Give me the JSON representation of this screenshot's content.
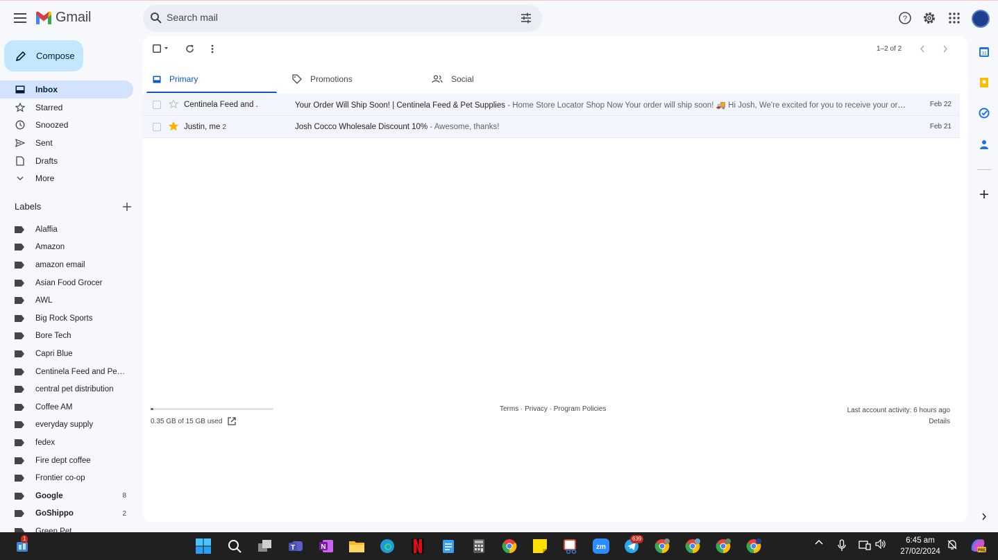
{
  "app": {
    "name": "Gmail"
  },
  "search": {
    "placeholder": "Search mail"
  },
  "compose": {
    "label": "Compose"
  },
  "nav": [
    {
      "label": "Inbox",
      "icon": "inbox-icon",
      "active": true
    },
    {
      "label": "Starred",
      "icon": "star-icon"
    },
    {
      "label": "Snoozed",
      "icon": "clock-icon"
    },
    {
      "label": "Sent",
      "icon": "send-icon"
    },
    {
      "label": "Drafts",
      "icon": "draft-icon"
    },
    {
      "label": "More",
      "icon": "chevron-down-icon"
    }
  ],
  "labels_header": "Labels",
  "labels": [
    {
      "name": "Alaffia",
      "count": ""
    },
    {
      "name": "Amazon",
      "count": ""
    },
    {
      "name": "amazon email",
      "count": ""
    },
    {
      "name": "Asian Food Grocer",
      "count": ""
    },
    {
      "name": "AWL",
      "count": ""
    },
    {
      "name": "Big Rock Sports",
      "count": ""
    },
    {
      "name": "Bore Tech",
      "count": ""
    },
    {
      "name": "Capri Blue",
      "count": ""
    },
    {
      "name": "Centinela Feed and Pet ...",
      "count": ""
    },
    {
      "name": "central pet distribution",
      "count": ""
    },
    {
      "name": "Coffee AM",
      "count": ""
    },
    {
      "name": "everyday supply",
      "count": ""
    },
    {
      "name": "fedex",
      "count": ""
    },
    {
      "name": "Fire dept coffee",
      "count": ""
    },
    {
      "name": "Frontier co-op",
      "count": ""
    },
    {
      "name": "Google",
      "count": "8",
      "bold": true
    },
    {
      "name": "GoShippo",
      "count": "2",
      "bold": true
    },
    {
      "name": "Green Pet",
      "count": ""
    }
  ],
  "toolbar": {
    "pager": "1–2 of 2"
  },
  "tabs": [
    {
      "label": "Primary",
      "icon": "inbox-icon"
    },
    {
      "label": "Promotions",
      "icon": "tag-icon"
    },
    {
      "label": "Social",
      "icon": "people-icon"
    }
  ],
  "emails": [
    {
      "sender": "Centinela Feed and .",
      "count": "",
      "starred": false,
      "subject": "Your Order Will Ship Soon! | Centinela Feed & Pet Supplies",
      "snippet": " - Home Store Locator Shop Now Your order will ship soon! 🚚 Hi Josh, We're excited for you to receive your order. Please see details below",
      "date": "Feb 22"
    },
    {
      "sender": "Justin, me",
      "count": "2",
      "starred": true,
      "subject": "Josh Cocco Wholesale Discount 10%",
      "snippet": " - Awesome, thanks!",
      "date": "Feb 21"
    }
  ],
  "storage": {
    "text": "0.35 GB of 15 GB used",
    "fraction": 0.023
  },
  "footer": {
    "links": "Terms · Privacy · Program Policies"
  },
  "activity": {
    "text": "Last account activity: 6 hours ago",
    "details": "Details"
  },
  "taskbar": {
    "start_badge": "1",
    "telegram_badge": "639",
    "time": "6:45 am",
    "date": "27/02/2024"
  },
  "colors": {
    "accent": "#0b57d0",
    "compose": "#c2e7ff",
    "active_nav": "#d3e3fd",
    "star": "#f4b400"
  }
}
